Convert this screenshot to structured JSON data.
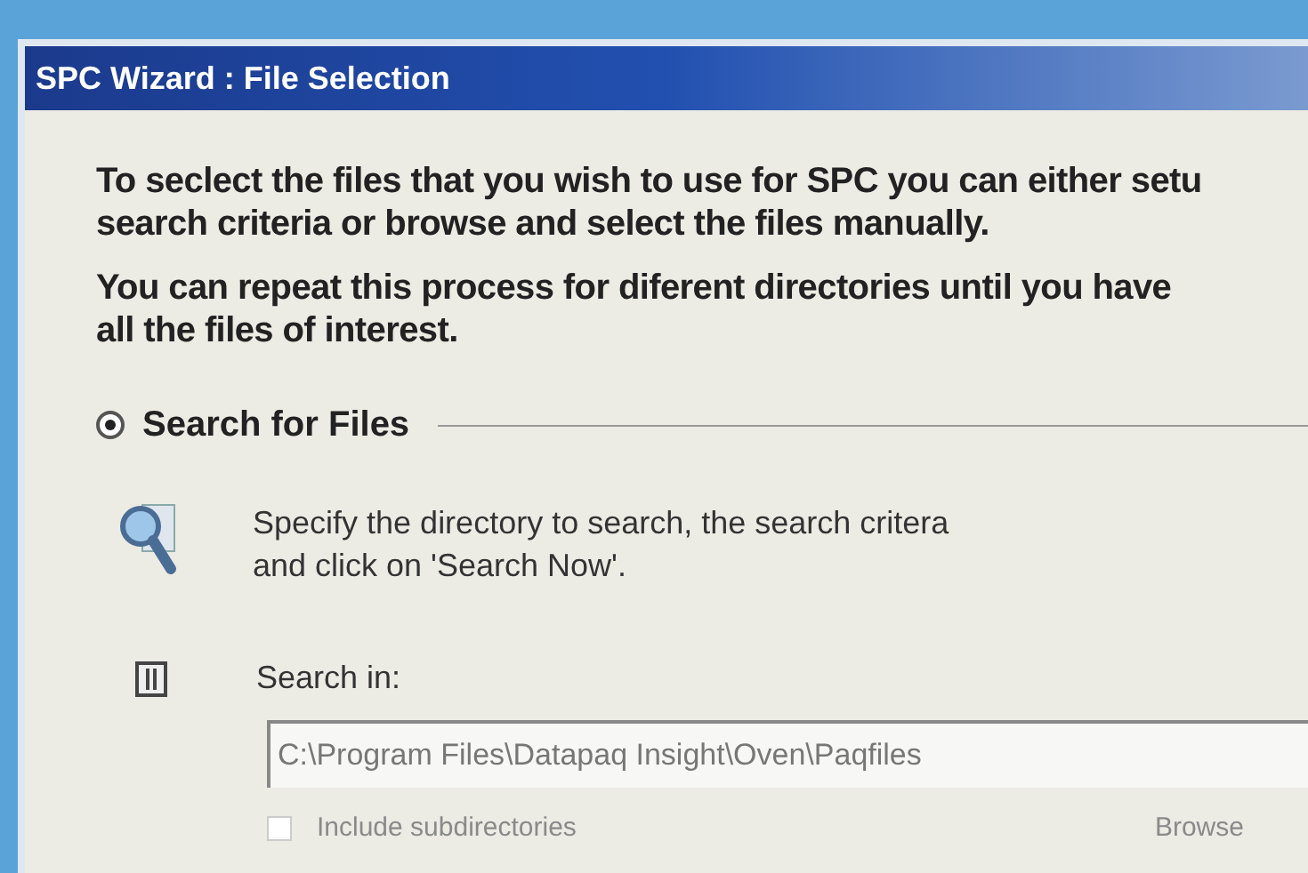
{
  "window": {
    "title": "SPC Wizard : File Selection"
  },
  "intro": [
    "To seclect the files that you wish to use for SPC you can either setu",
    "search criteria or browse and select the files manually."
  ],
  "repeat_note": [
    "You can repeat this process for diferent directories until you have",
    "all the files of interest."
  ],
  "search_option": {
    "label": "Search for Files",
    "selected": true
  },
  "instruction": [
    "Specify the directory to search, the search critera",
    "and click on 'Search Now'."
  ],
  "search_in": {
    "label": "Search in:",
    "value": "C:\\Program Files\\Datapaq Insight\\Oven\\Paqfiles"
  },
  "include_subdirectories": {
    "label": "Include subdirectories",
    "checked": false,
    "disabled": true
  },
  "browse_button": {
    "label": "Browse",
    "disabled": true
  }
}
